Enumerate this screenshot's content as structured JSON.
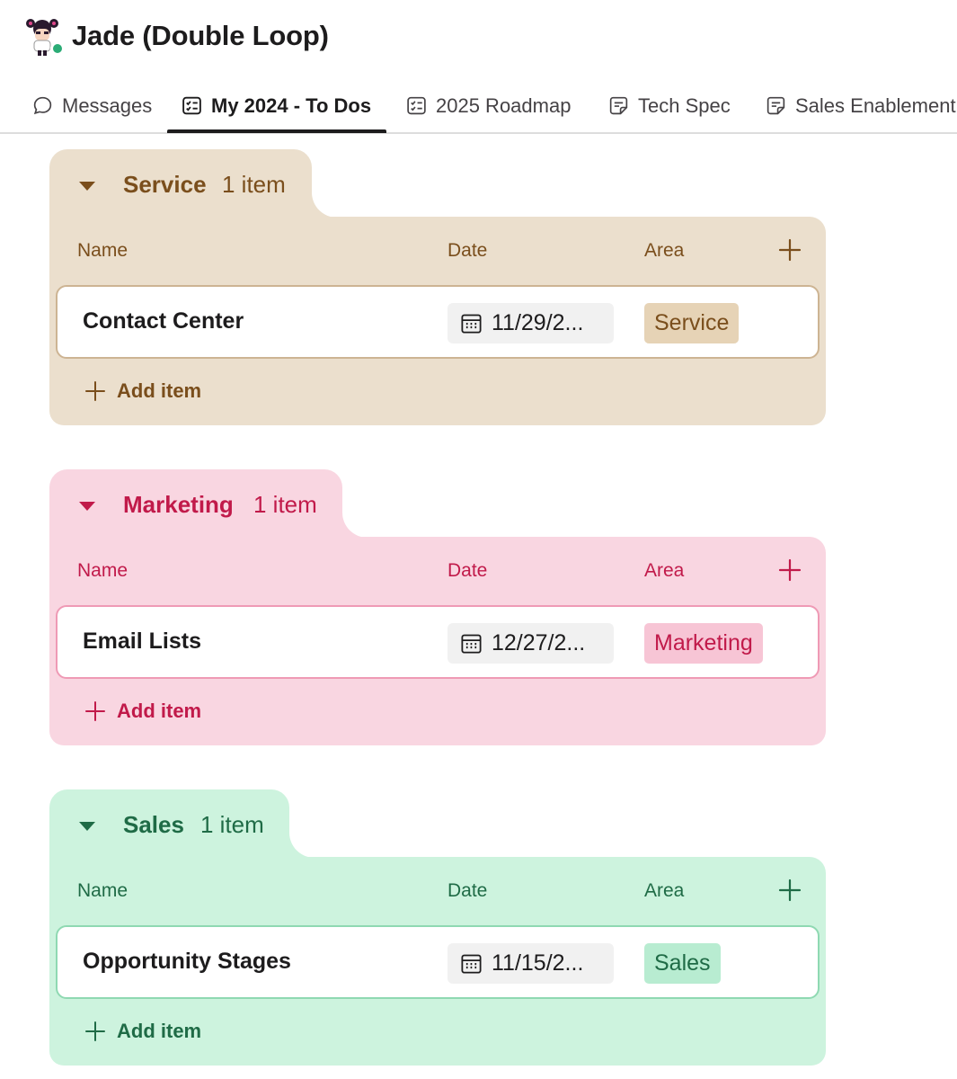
{
  "header": {
    "title": "Jade (Double Loop)",
    "avatar_icon": "cartoon-avatar",
    "presence_color": "#2bac76"
  },
  "tabs": [
    {
      "label": "Messages",
      "icon": "chat-bubble-icon",
      "active": false
    },
    {
      "label": "My 2024 - To Dos",
      "icon": "checklist-icon",
      "active": true
    },
    {
      "label": "2025 Roadmap",
      "icon": "checklist-icon",
      "active": false
    },
    {
      "label": "Tech Spec",
      "icon": "canvas-note-icon",
      "active": false
    },
    {
      "label": "Sales Enablement",
      "icon": "canvas-note-icon",
      "active": false
    }
  ],
  "columns": {
    "name": "Name",
    "date": "Date",
    "area": "Area"
  },
  "add_item_label": "Add item",
  "groups": [
    {
      "name": "Service",
      "count": "1 item",
      "theme": "#ebdfcd",
      "rows": [
        {
          "name": "Contact Center",
          "date": "11/29/2...",
          "area": "Service"
        }
      ]
    },
    {
      "name": "Marketing",
      "count": "1 item",
      "theme": "#f9d6e1",
      "rows": [
        {
          "name": "Email Lists",
          "date": "12/27/2...",
          "area": "Marketing"
        }
      ]
    },
    {
      "name": "Sales",
      "count": "1 item",
      "theme": "#cdf3de",
      "rows": [
        {
          "name": "Opportunity Stages",
          "date": "11/15/2...",
          "area": "Sales"
        }
      ]
    }
  ]
}
